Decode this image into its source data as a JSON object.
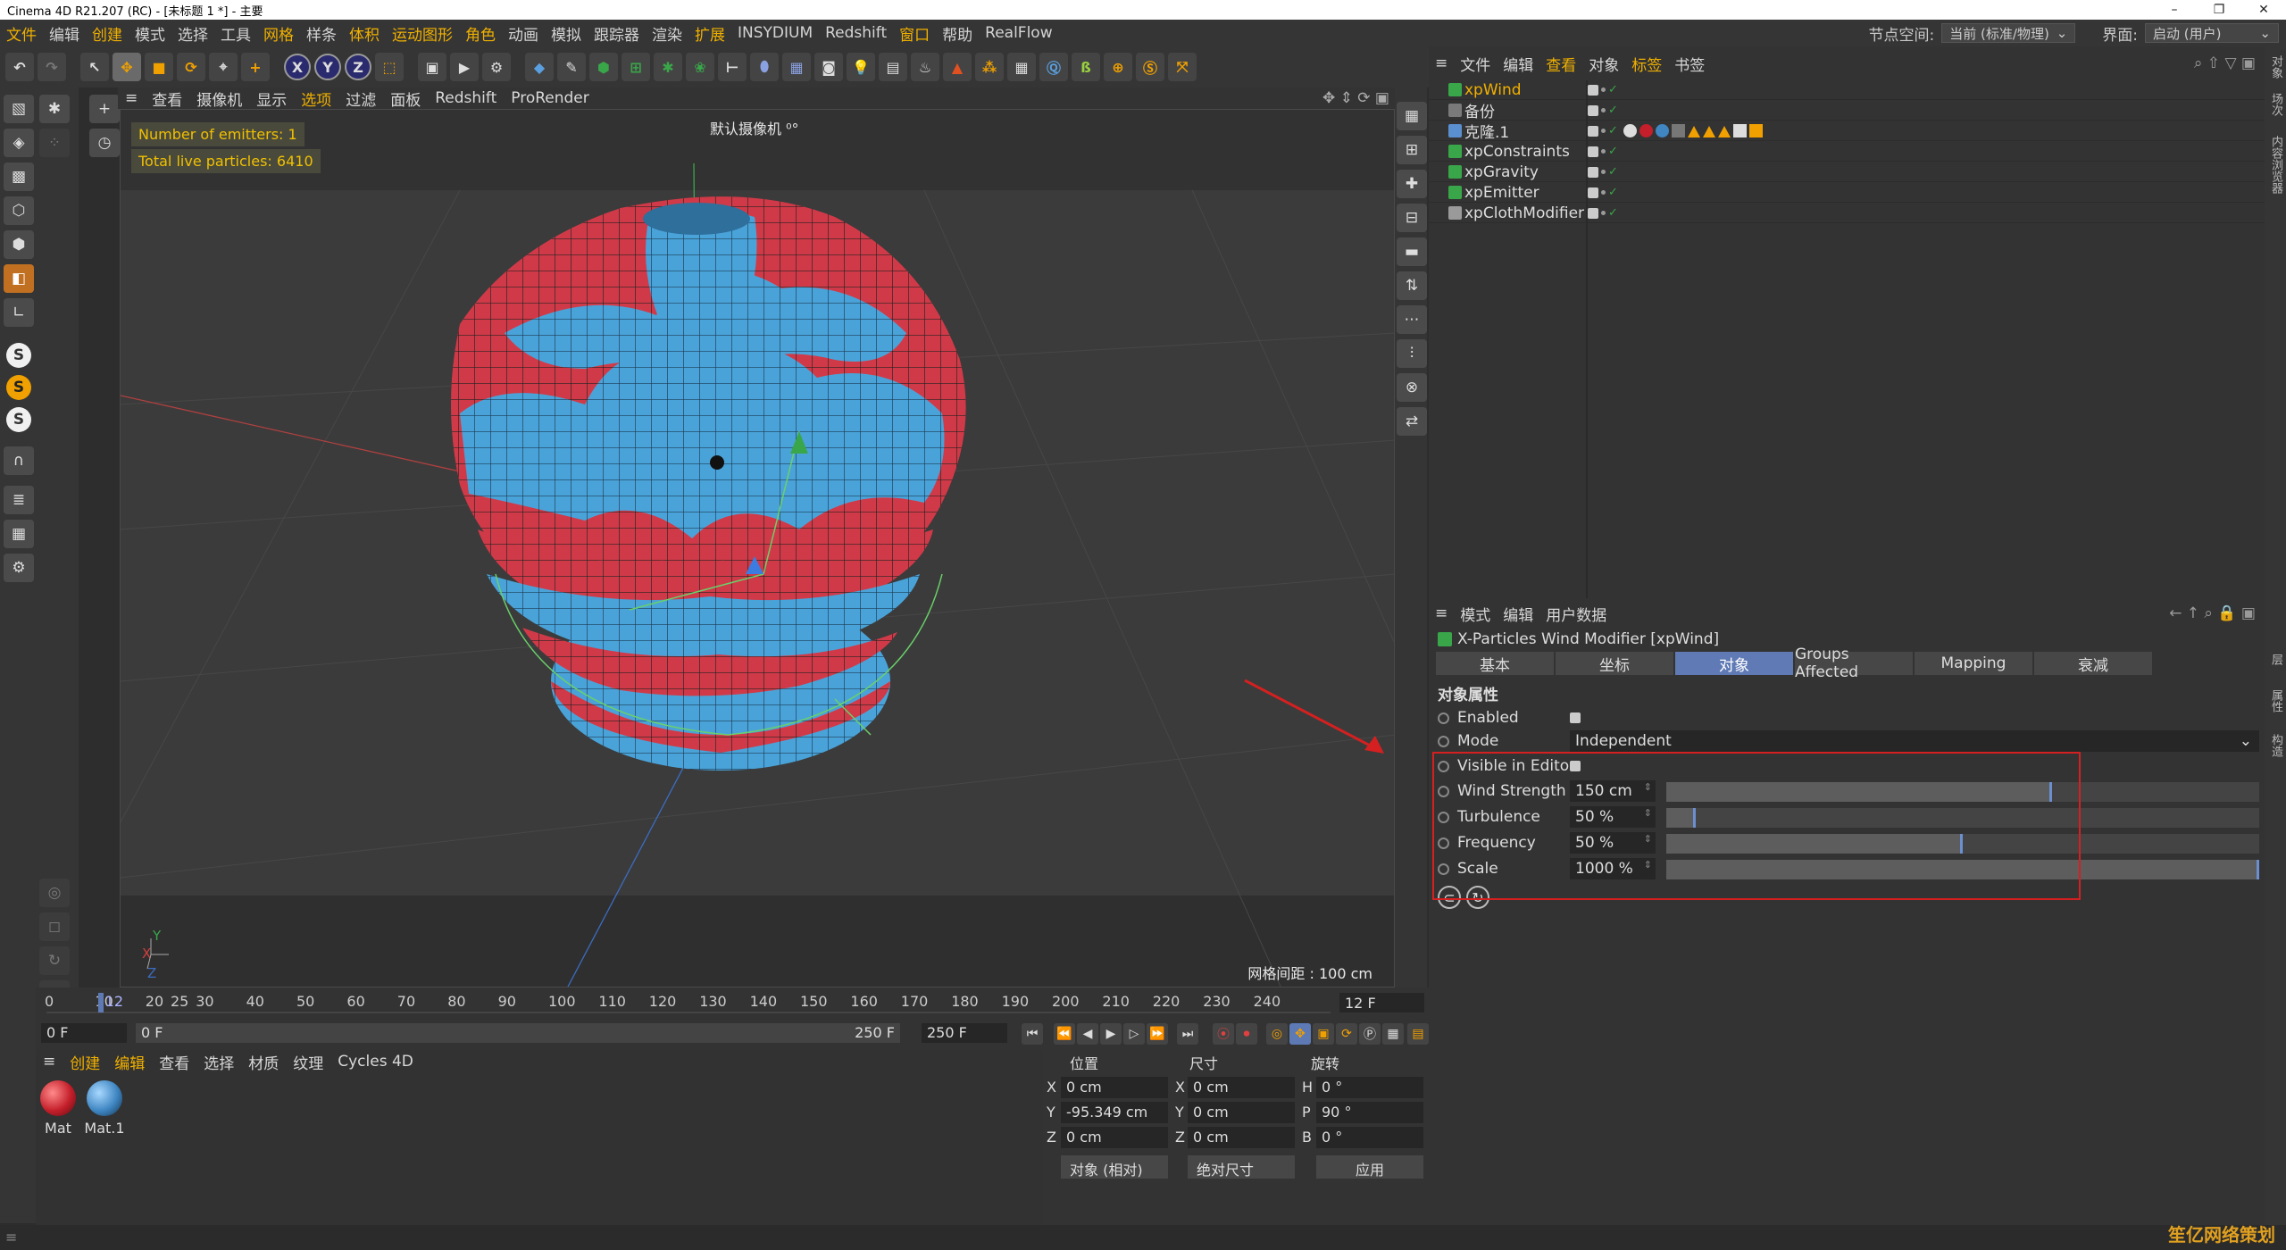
{
  "window": {
    "title": "Cinema 4D R21.207 (RC) - [未标题 1 *] - 主要"
  },
  "menu": {
    "items": [
      "文件",
      "编辑",
      "创建",
      "模式",
      "选择",
      "工具",
      "网格",
      "样条",
      "体积",
      "运动图形",
      "角色",
      "动画",
      "模拟",
      "跟踪器",
      "渲染",
      "扩展",
      "INSYDIUM",
      "Redshift",
      "窗口",
      "帮助",
      "RealFlow"
    ],
    "node_space_label": "节点空间:",
    "node_space_value": "当前 (标准/物理)",
    "layout_label": "界面:",
    "layout_value": "启动 (用户)"
  },
  "toolbar": {
    "axis_x": "X",
    "axis_y": "Y",
    "axis_z": "Z",
    "icons": [
      "undo-icon",
      "redo-icon",
      "select-icon",
      "move-icon",
      "scale-icon",
      "rotate-icon",
      "live-select-icon",
      "add-icon"
    ]
  },
  "viewport": {
    "menu": [
      "查看",
      "摄像机",
      "显示",
      "选项",
      "过滤",
      "面板",
      "Redshift",
      "ProRender"
    ],
    "emitters_text": "Number of emitters: 1",
    "particles_text": "Total live particles: 6410",
    "camera_label": "默认摄像机 ⁰°",
    "grid_spacing": "网格间距 : 100 cm",
    "axis_x": "X",
    "axis_y": "Y",
    "axis_z": "Z"
  },
  "timeline": {
    "ticks": [
      "0",
      "10",
      "12",
      "20",
      "30",
      "40",
      "50",
      "60",
      "70",
      "80",
      "90",
      "100",
      "110",
      "120",
      "130",
      "140",
      "150",
      "160",
      "170",
      "180",
      "190",
      "200",
      "210",
      "220",
      "230",
      "240",
      "25"
    ],
    "current_frame": "12 F",
    "start": "0 F",
    "range_start": "0 F",
    "range_end": "250 F",
    "end": "250 F"
  },
  "material_manager": {
    "menu": [
      "创建",
      "编辑",
      "查看",
      "选择",
      "材质",
      "纹理",
      "Cycles 4D"
    ],
    "materials": [
      {
        "name": "Mat",
        "color": "#c41f2a"
      },
      {
        "name": "Mat.1",
        "color": "#3f86c2"
      }
    ]
  },
  "coordinates": {
    "headers": {
      "position": "位置",
      "size": "尺寸",
      "rotation": "旋转"
    },
    "rows": [
      {
        "a": "X",
        "pos": "0 cm",
        "b": "X",
        "size": "0 cm",
        "c": "H",
        "rot": "0 °"
      },
      {
        "a": "Y",
        "pos": "-95.349 cm",
        "b": "Y",
        "size": "0 cm",
        "c": "P",
        "rot": "90 °"
      },
      {
        "a": "Z",
        "pos": "0 cm",
        "b": "Z",
        "size": "0 cm",
        "c": "B",
        "rot": "0 °"
      }
    ],
    "mode": "对象 (相对)",
    "size_mode": "绝对尺寸",
    "apply": "应用"
  },
  "object_manager": {
    "menu": [
      "文件",
      "编辑",
      "查看",
      "对象",
      "标签",
      "书签"
    ],
    "objects": [
      {
        "name": "xpWind",
        "active": true,
        "color": "#3aa64a"
      },
      {
        "name": "备份",
        "active": false,
        "color": "#7a7a7a"
      },
      {
        "name": "克隆.1",
        "active": false,
        "color": "#5a8fd0"
      },
      {
        "name": "xpConstraints",
        "active": false,
        "color": "#3aa64a"
      },
      {
        "name": "xpGravity",
        "active": false,
        "color": "#3aa64a"
      },
      {
        "name": "xpEmitter",
        "active": false,
        "color": "#3aa64a"
      },
      {
        "name": "xpClothModifier",
        "active": false,
        "color": "#9a9a9a"
      }
    ]
  },
  "attributes": {
    "menu": [
      "模式",
      "编辑",
      "用户数据"
    ],
    "title": "X-Particles Wind Modifier [xpWind]",
    "tabs": [
      "基本",
      "坐标",
      "对象",
      "Groups Affected",
      "Mapping",
      "衰减"
    ],
    "active_tab": "对象",
    "section": "对象属性",
    "enabled_label": "Enabled",
    "mode_label": "Mode",
    "mode_value": "Independent",
    "visible_label": "Visible in Editor",
    "params": [
      {
        "label": "Wind Strength",
        "value": "150 cm",
        "level": 0.65
      },
      {
        "label": "Turbulence",
        "value": "50 %",
        "level": 0.05
      },
      {
        "label": "Frequency",
        "value": "50 %",
        "level": 0.5
      },
      {
        "label": "Scale",
        "value": "1000 %",
        "level": 1.0
      }
    ]
  },
  "side_tabs": [
    "对象",
    "场次",
    "内容浏览器",
    "层",
    "属性",
    "构造"
  ],
  "watermark": "笙亿网络策划"
}
